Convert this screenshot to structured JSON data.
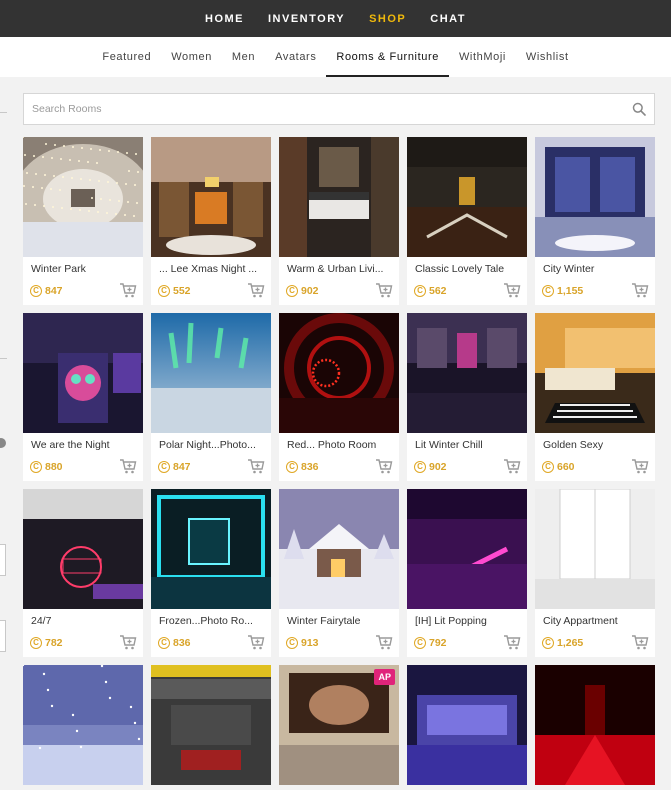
{
  "topnav": {
    "items": [
      {
        "label": "HOME",
        "active": false
      },
      {
        "label": "INVENTORY",
        "active": false
      },
      {
        "label": "SHOP",
        "active": true
      },
      {
        "label": "CHAT",
        "active": false
      }
    ]
  },
  "subnav": {
    "tabs": [
      {
        "label": "Featured",
        "active": false
      },
      {
        "label": "Women",
        "active": false
      },
      {
        "label": "Men",
        "active": false
      },
      {
        "label": "Avatars",
        "active": false
      },
      {
        "label": "Rooms & Furniture",
        "active": true
      },
      {
        "label": "WithMoji",
        "active": false
      },
      {
        "label": "Wishlist",
        "active": false
      }
    ]
  },
  "search": {
    "placeholder": "Search Rooms",
    "icon": "search-icon"
  },
  "currency_symbol": "C",
  "colors": {
    "accent": "#f0b90b",
    "price": "#d9a42a",
    "badge": "#e0247a"
  },
  "products": [
    {
      "name": "Winter Park",
      "price": "847",
      "scene": "winter-park"
    },
    {
      "name": "... Lee Xmas Night ...",
      "price": "552",
      "scene": "xmas-night"
    },
    {
      "name": "Warm & Urban Livi...",
      "price": "902",
      "scene": "urban-living"
    },
    {
      "name": "Classic Lovely Tale",
      "price": "562",
      "scene": "classic-tale"
    },
    {
      "name": "City Winter",
      "price": "1,155",
      "scene": "city-winter"
    },
    {
      "name": "We are the Night",
      "price": "880",
      "scene": "night"
    },
    {
      "name": "Polar Night...Photo...",
      "price": "847",
      "scene": "polar-night"
    },
    {
      "name": "Red... Photo Room",
      "price": "836",
      "scene": "red-photo"
    },
    {
      "name": "Lit Winter Chill",
      "price": "902",
      "scene": "winter-chill"
    },
    {
      "name": "Golden Sexy",
      "price": "660",
      "scene": "golden"
    },
    {
      "name": "24/7",
      "price": "782",
      "scene": "open247"
    },
    {
      "name": "Frozen...Photo Ro...",
      "price": "836",
      "scene": "frozen"
    },
    {
      "name": "Winter Fairytale",
      "price": "913",
      "scene": "fairytale"
    },
    {
      "name": "[IH] Lit Popping",
      "price": "792",
      "scene": "lit-popping"
    },
    {
      "name": "City Appartment",
      "price": "1,265",
      "scene": "apartment"
    },
    {
      "name": "",
      "price": "",
      "scene": "blue-snow"
    },
    {
      "name": "",
      "price": "",
      "scene": "caution"
    },
    {
      "name": "",
      "price": "",
      "scene": "ap-photo",
      "badge": "AP"
    },
    {
      "name": "",
      "price": "",
      "scene": "purple-room"
    },
    {
      "name": "",
      "price": "",
      "scene": "red-dark"
    }
  ]
}
